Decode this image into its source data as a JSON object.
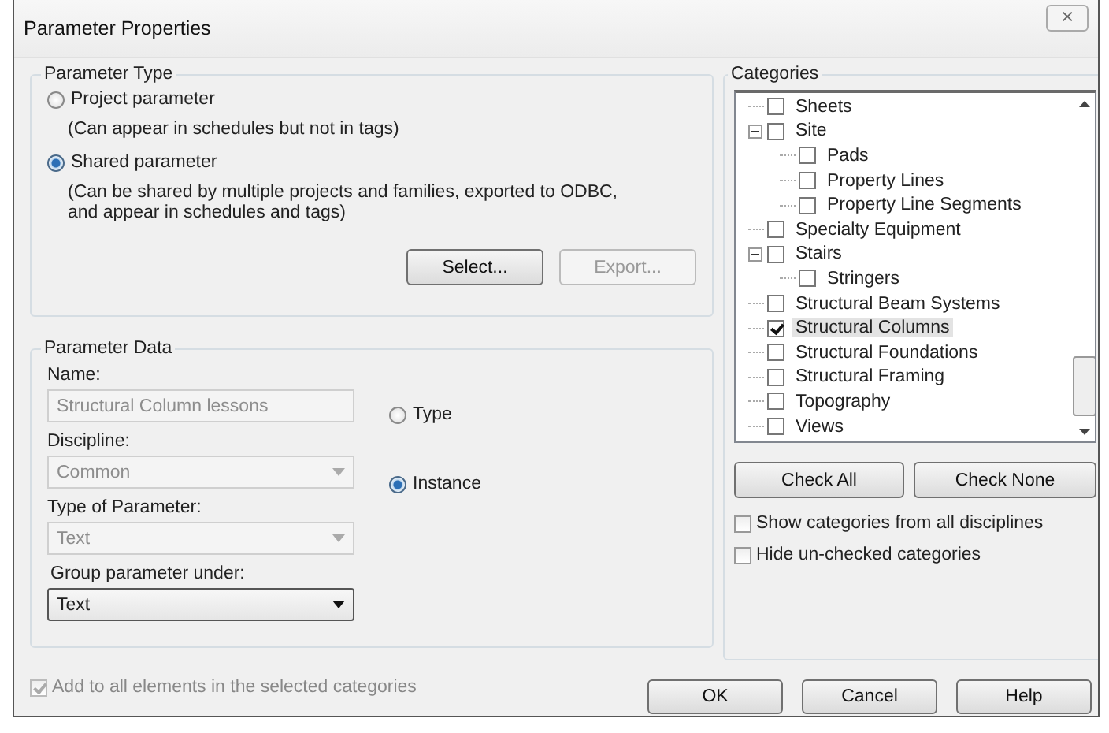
{
  "window": {
    "title": "Parameter Properties",
    "close": "⨯"
  },
  "parameter_type": {
    "title": "Parameter Type",
    "options": [
      {
        "label": "Project parameter",
        "selected": false,
        "description": "(Can appear in schedules but not in tags)"
      },
      {
        "label": "Shared parameter",
        "selected": true,
        "description": "(Can be shared by multiple projects and families, exported to ODBC, and appear in schedules and tags)"
      }
    ],
    "buttons": [
      {
        "label": "Select...",
        "disabled": false
      },
      {
        "label": "Export...",
        "disabled": true
      }
    ]
  },
  "parameter_data": {
    "title": "Parameter Data",
    "name": {
      "label": "Name:",
      "value": "Structural Column lessons",
      "disabled": true
    },
    "discipline": {
      "label": "Discipline:",
      "value": "Common",
      "disabled": true
    },
    "type_of_parameter": {
      "label": "Type of Parameter:",
      "value": "Text",
      "disabled": true
    },
    "group_under": {
      "label": "Group parameter under:",
      "value": "Text",
      "disabled": false
    },
    "scope": [
      {
        "label": "Type",
        "selected": false
      },
      {
        "label": "Instance",
        "selected": true
      }
    ]
  },
  "add_to_all": {
    "label": "Add to all elements in the selected categories",
    "checked": true,
    "disabled": true
  },
  "categories": {
    "title": "Categories",
    "items": [
      {
        "label": "Sheets",
        "checked": false,
        "selected": false
      },
      {
        "label": "Site",
        "checked": false,
        "selected": false,
        "expanded": true,
        "children": [
          {
            "label": "Pads",
            "checked": false,
            "selected": false
          },
          {
            "label": "Property Lines",
            "checked": false,
            "selected": false
          },
          {
            "label": "Property Line Segments",
            "checked": false,
            "selected": false
          }
        ]
      },
      {
        "label": "Specialty Equipment",
        "checked": false,
        "selected": false
      },
      {
        "label": "Stairs",
        "checked": false,
        "selected": false,
        "expanded": true,
        "children": [
          {
            "label": "Stringers",
            "checked": false,
            "selected": false
          }
        ]
      },
      {
        "label": "Structural Beam Systems",
        "checked": false,
        "selected": false
      },
      {
        "label": "Structural Columns",
        "checked": true,
        "selected": true
      },
      {
        "label": "Structural Foundations",
        "checked": false,
        "selected": false
      },
      {
        "label": "Structural Framing",
        "checked": false,
        "selected": false
      },
      {
        "label": "Topography",
        "checked": false,
        "selected": false
      },
      {
        "label": "Views",
        "checked": false,
        "selected": false
      }
    ],
    "buttons": [
      "Check All",
      "Check None"
    ],
    "options": [
      {
        "label": "Show categories from all disciplines",
        "checked": false
      },
      {
        "label": "Hide un-checked categories",
        "checked": false
      }
    ]
  },
  "buttons": [
    "OK",
    "Cancel",
    "Help"
  ]
}
